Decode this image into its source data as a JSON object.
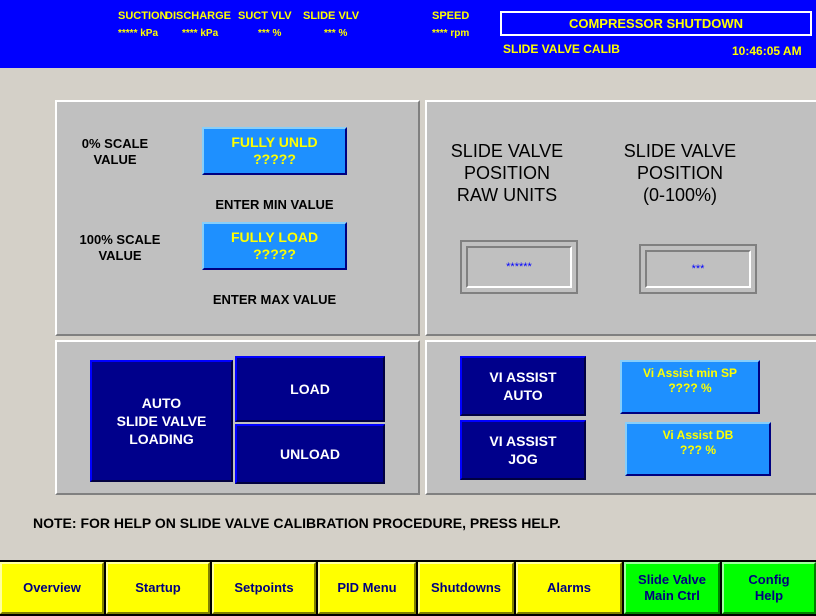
{
  "header": {
    "labels": [
      "SUCTION",
      "DISCHARGE",
      "SUCT VLV",
      "SLIDE VLV",
      "SPEED"
    ],
    "values": [
      "***** kPa",
      "**** kPa",
      "*** %",
      "*** %",
      "**** rpm"
    ],
    "status": "COMPRESSOR SHUTDOWN",
    "mode": "SLIDE VALVE CALIB",
    "time": "10:46:05 AM"
  },
  "calibration": {
    "zero_label": "0% SCALE\nVALUE",
    "fully_unld_label": "FULLY UNLD",
    "fully_unld_value": "?????",
    "enter_min": "ENTER MIN VALUE",
    "hundred_label": "100% SCALE\nVALUE",
    "fully_load_label": "FULLY LOAD",
    "fully_load_value": "?????",
    "enter_max": "ENTER MAX VALUE"
  },
  "position": {
    "raw_title": "SLIDE VALVE\nPOSITION\nRAW UNITS",
    "raw_value": "******",
    "pct_title": "SLIDE VALVE\nPOSITION\n(0-100%)",
    "pct_value": "***"
  },
  "loading": {
    "auto_label": "AUTO\nSLIDE VALVE\nLOADING",
    "load_label": "LOAD",
    "unload_label": "UNLOAD"
  },
  "vi_assist": {
    "auto_label": "VI ASSIST\nAUTO",
    "jog_label": "VI ASSIST\nJOG",
    "min_sp_label": "Vi Assist min SP",
    "min_sp_value": "???? %",
    "db_label": "Vi Assist DB",
    "db_value": "??? %"
  },
  "note": "NOTE: FOR HELP ON SLIDE VALVE CALIBRATION PROCEDURE, PRESS  HELP.",
  "nav": [
    {
      "label": "Overview"
    },
    {
      "label": "Startup"
    },
    {
      "label": "Setpoints"
    },
    {
      "label": "PID Menu"
    },
    {
      "label": "Shutdowns"
    },
    {
      "label": "Alarms"
    },
    {
      "label": "Slide Valve\nMain Ctrl"
    },
    {
      "label": "Config\nHelp"
    }
  ],
  "colors": {
    "header_bg": "#0000ff",
    "header_text": "#ffff00",
    "cyan_button": "#1e90ff",
    "navy_button": "#00008b",
    "nav_yellow": "#ffff00",
    "nav_green": "#00ff00",
    "readout_text": "#0000ff"
  }
}
